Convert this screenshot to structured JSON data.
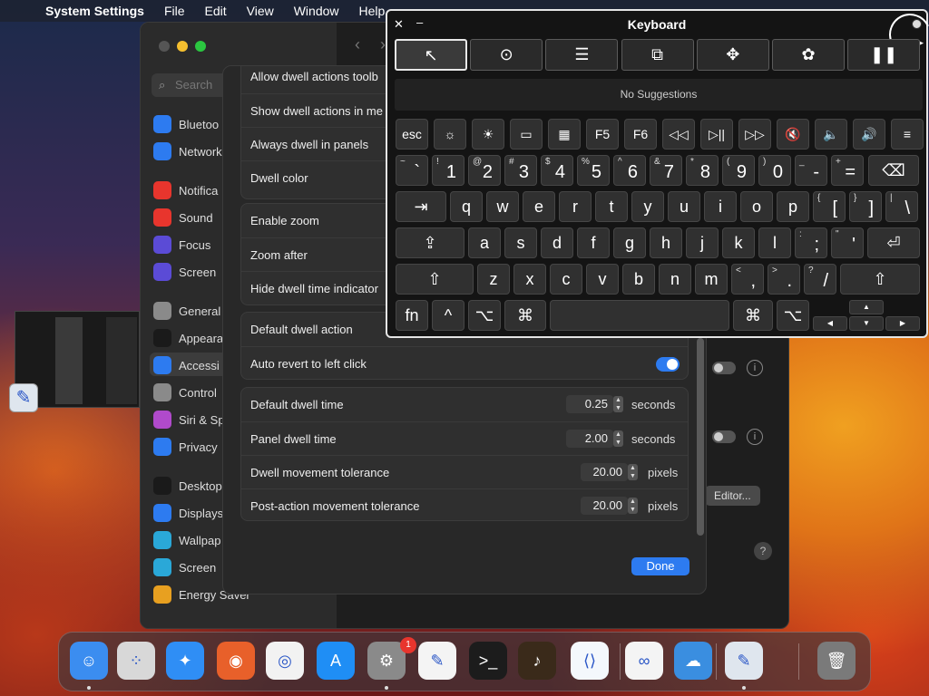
{
  "menubar": {
    "app": "System Settings",
    "items": [
      "File",
      "Edit",
      "View",
      "Window",
      "Help"
    ]
  },
  "settings": {
    "search_placeholder": "Search",
    "sidebar": [
      {
        "label": "Bluetooth",
        "icon": "bluetooth-icon",
        "color": "#2d7bf0"
      },
      {
        "label": "Network",
        "icon": "network-icon",
        "color": "#2d7bf0"
      },
      {
        "label": "Notifications",
        "icon": "bell-icon",
        "color": "#e8352d"
      },
      {
        "label": "Sound",
        "icon": "speaker-icon",
        "color": "#e8352d"
      },
      {
        "label": "Focus",
        "icon": "moon-icon",
        "color": "#5b4bd6"
      },
      {
        "label": "Screen Time",
        "icon": "hourglass-icon",
        "color": "#5b4bd6"
      },
      {
        "label": "General",
        "icon": "gear-icon",
        "color": "#8a8a8a"
      },
      {
        "label": "Appearance",
        "icon": "appearance-icon",
        "color": "#1a1a1a"
      },
      {
        "label": "Accessibility",
        "icon": "accessibility-icon",
        "color": "#2d7bf0"
      },
      {
        "label": "Control Centre",
        "icon": "control-centre-icon",
        "color": "#8a8a8a"
      },
      {
        "label": "Siri & Spotlight",
        "icon": "siri-icon",
        "color": "#b04acb"
      },
      {
        "label": "Privacy & Security",
        "icon": "hand-icon",
        "color": "#2d7bf0"
      },
      {
        "label": "Desktop & Dock",
        "icon": "desktop-icon",
        "color": "#1a1a1a"
      },
      {
        "label": "Displays",
        "icon": "display-icon",
        "color": "#2d7bf0"
      },
      {
        "label": "Wallpaper",
        "icon": "wallpaper-icon",
        "color": "#2aa8d8"
      },
      {
        "label": "Screen Saver",
        "icon": "screensaver-icon",
        "color": "#2aa8d8"
      },
      {
        "label": "Energy Saver",
        "icon": "energy-icon",
        "color": "#e8a020"
      }
    ],
    "sidebar_visible": [
      "Bluetoo",
      "Network",
      "Notifica",
      "Sound",
      "Focus",
      "Screen",
      "General",
      "Appeara",
      "Accessi",
      "Control",
      "Siri & Sp",
      "Privacy",
      "Desktop",
      "Displays",
      "Wallpap",
      "Screen",
      "Energy Saver"
    ],
    "editor_button": "Editor...",
    "help": "?"
  },
  "sheet": {
    "group1": [
      "Allow dwell actions toolb",
      "Show dwell actions in me",
      "Always dwell in panels",
      "Dwell color"
    ],
    "group2": [
      "Enable zoom",
      "Zoom after",
      "Hide dwell time indicator"
    ],
    "group3": {
      "default_action": "Default dwell action",
      "auto_revert": "Auto revert to left click",
      "auto_revert_on": true
    },
    "group4": [
      {
        "label": "Default dwell time",
        "value": "0.25",
        "unit": "seconds"
      },
      {
        "label": "Panel dwell time",
        "value": "2.00",
        "unit": "seconds"
      },
      {
        "label": "Dwell movement tolerance",
        "value": "20.00",
        "unit": "pixels"
      },
      {
        "label": "Post-action movement tolerance",
        "value": "20.00",
        "unit": "pixels"
      }
    ],
    "done": "Done"
  },
  "keyboard": {
    "title": "Keyboard",
    "close": "✕",
    "minimize": "–",
    "toolbar": [
      "left-click-icon",
      "double-click-icon",
      "context-menu-icon",
      "drag-icon",
      "move-icon",
      "scroll-icon",
      "pause-icon"
    ],
    "suggestions": "No Suggestions",
    "fn_row": [
      "esc",
      "☼",
      "☀",
      "▭",
      "▦",
      "F5",
      "F6",
      "◁◁",
      "▷||",
      "▷▷",
      "🔇",
      "🔈",
      "🔊",
      "≡"
    ],
    "num_row": [
      [
        "~",
        "`"
      ],
      [
        "!",
        "1"
      ],
      [
        "@",
        "2"
      ],
      [
        "#",
        "3"
      ],
      [
        "$",
        "4"
      ],
      [
        "%",
        "5"
      ],
      [
        "^",
        "6"
      ],
      [
        "&",
        "7"
      ],
      [
        "*",
        "8"
      ],
      [
        "(",
        "9"
      ],
      [
        ")",
        "0"
      ],
      [
        "_",
        "-"
      ],
      [
        "+",
        "="
      ]
    ],
    "delete": "⌫",
    "tab": "⇥",
    "q_row": [
      "q",
      "w",
      "e",
      "r",
      "t",
      "y",
      "u",
      "i",
      "o",
      "p"
    ],
    "q_row_sym": [
      [
        "{",
        "["
      ],
      [
        "}",
        "]"
      ],
      [
        "|",
        "\\"
      ]
    ],
    "caps": "⇪",
    "a_row": [
      "a",
      "s",
      "d",
      "f",
      "g",
      "h",
      "j",
      "k",
      "l"
    ],
    "a_row_sym": [
      [
        ":",
        ";"
      ],
      [
        "\"",
        "'"
      ]
    ],
    "return": "⏎",
    "shift": "⇧",
    "z_row": [
      "z",
      "x",
      "c",
      "v",
      "b",
      "n",
      "m"
    ],
    "z_row_sym": [
      [
        "<",
        ","
      ],
      [
        ">",
        "."
      ],
      [
        "?",
        "/"
      ]
    ],
    "fn": "fn",
    "ctrl": "^",
    "opt": "⌥",
    "cmd": "⌘",
    "arrows": [
      "▲",
      "◀",
      "▼",
      "▶"
    ]
  },
  "dock": {
    "apps": [
      {
        "name": "Finder",
        "icon": "finder-icon",
        "color": "#3b8df0",
        "running": true
      },
      {
        "name": "Launchpad",
        "icon": "launchpad-icon",
        "color": "#d8d8d8",
        "running": false
      },
      {
        "name": "Safari",
        "icon": "safari-icon",
        "color": "#2f8ef5",
        "running": false
      },
      {
        "name": "Firefox",
        "icon": "firefox-icon",
        "color": "#e8602a",
        "running": false
      },
      {
        "name": "Chrome",
        "icon": "chrome-icon",
        "color": "#f2f2f2",
        "running": false
      },
      {
        "name": "App Store",
        "icon": "app-store-icon",
        "color": "#1f8ef5",
        "running": false
      },
      {
        "name": "System Settings",
        "icon": "system-settings-icon",
        "color": "#8a8a8a",
        "running": true
      },
      {
        "name": "TextEdit",
        "icon": "textedit-icon",
        "color": "#f4f4f4",
        "running": false
      },
      {
        "name": "Terminal",
        "icon": "terminal-icon",
        "color": "#1c1c1c",
        "running": false
      },
      {
        "name": "GarageBand",
        "icon": "garageband-icon",
        "color": "#3a2a1a",
        "running": false
      },
      {
        "name": "Visual Studio Code",
        "icon": "vscode-icon",
        "color": "#f4f8fc",
        "running": false
      },
      {
        "name": "Visual Studio",
        "icon": "visual-studio-icon",
        "color": "#f4f4f4",
        "running": false
      },
      {
        "name": "Weather",
        "icon": "weather-icon",
        "color": "#3a8ee0",
        "running": false
      },
      {
        "name": "Accessibility Keyboard",
        "icon": "keyboard-viewer-icon",
        "color": "#dfe6ee",
        "running": true
      },
      {
        "name": "Trash",
        "icon": "trash-icon",
        "color": "#7a7a7a",
        "running": false
      }
    ],
    "badge": "1"
  }
}
